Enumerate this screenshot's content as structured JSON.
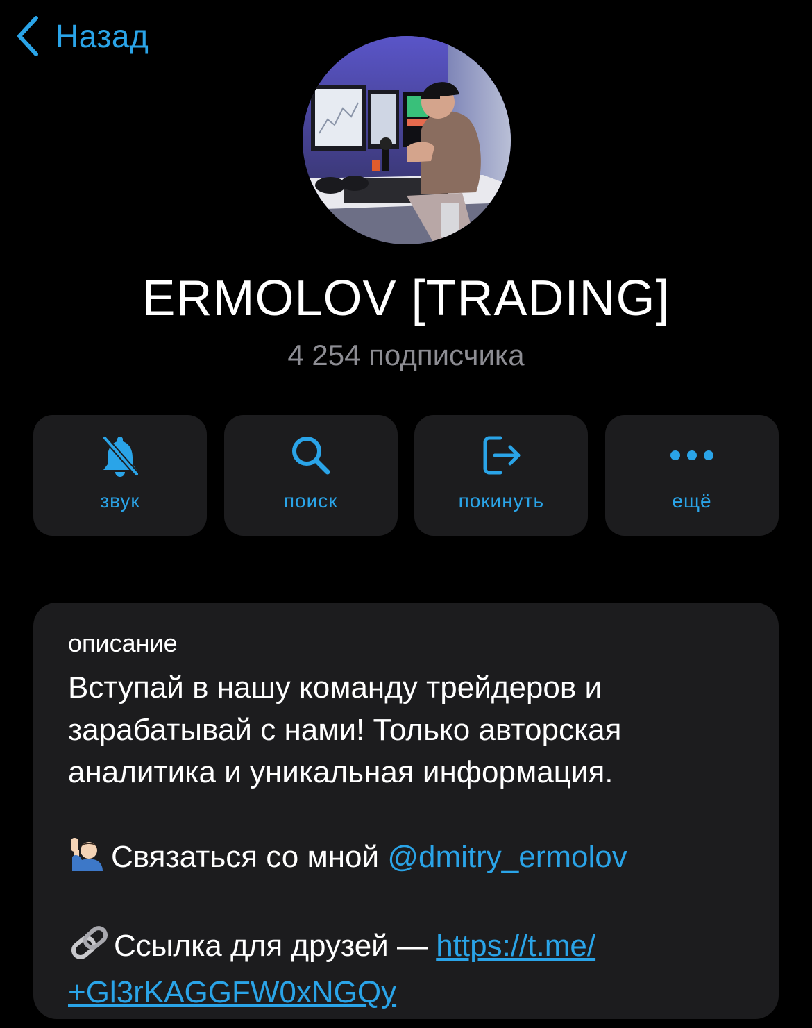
{
  "nav": {
    "back_label": "Назад",
    "back_icon": "chevron-left-icon",
    "accent": "#2aa4e8"
  },
  "channel": {
    "title": "ERMOLOV [TRADING]",
    "subscribers": "4 254 подписчика"
  },
  "actions": [
    {
      "label": "звук",
      "icon": "bell-slash-icon"
    },
    {
      "label": "поиск",
      "icon": "search-icon"
    },
    {
      "label": "покинуть",
      "icon": "leave-icon"
    },
    {
      "label": "ещё",
      "icon": "more-dots-icon"
    }
  ],
  "description": {
    "heading": "описание",
    "lines": [
      "Вступай в нашу команду трейдеров и",
      "зарабатывай с нами! Только авторская",
      "аналитика и уникальная информация."
    ],
    "contact_text": "Связаться со мной ",
    "contact_handle": "@dmitry_ermolov",
    "contact_emoji": "person-raising-hand-icon",
    "friends_text": "Ссылка для друзей — ",
    "friends_link_part1": "https://t.me/",
    "friends_link_part2": "+Gl3rKAGGFW0xNGQy",
    "friends_emoji": "link-icon"
  },
  "colors": {
    "background": "#000000",
    "card": "#1c1c1e",
    "secondary_text": "#8d8d93"
  }
}
